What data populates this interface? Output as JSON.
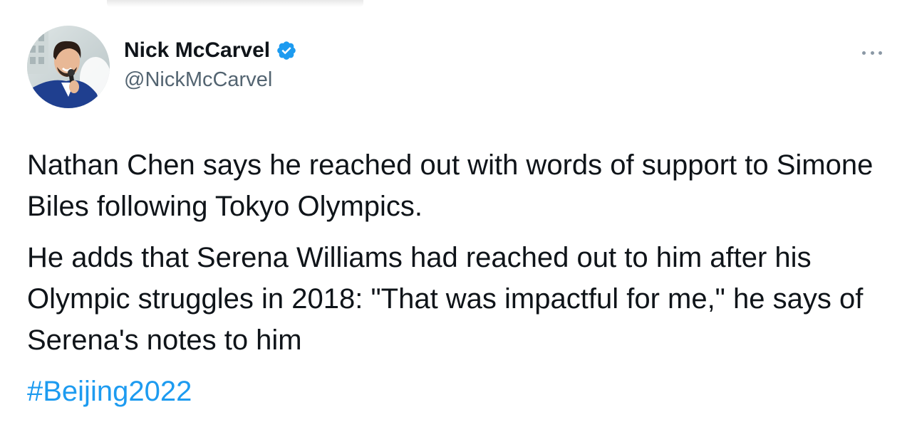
{
  "author": {
    "display_name": "Nick McCarvel",
    "handle": "@NickMcCarvel",
    "verified": true,
    "verified_color": "#1d9bf0"
  },
  "icons": {
    "more": "more-horizontal-icon",
    "verified": "verified-badge-icon"
  },
  "tweet": {
    "paragraphs": [
      "Nathan Chen says he reached out with words of support to Simone Biles following Tokyo Olympics.",
      "He adds that Serena Williams had reached out to him after his Olympic struggles in 2018: \"That was impactful for me,\" he says of Serena's notes to him"
    ],
    "hashtag": "#Beijing2022",
    "link_color": "#1d9bf0"
  }
}
